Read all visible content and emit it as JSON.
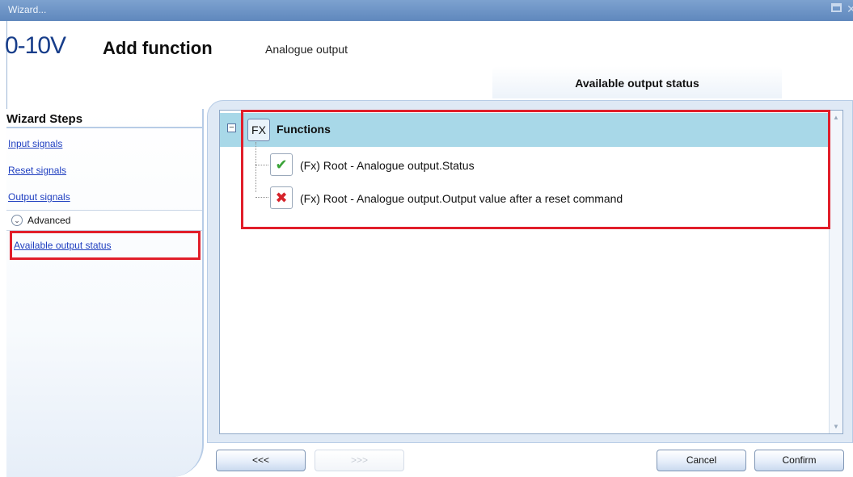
{
  "window": {
    "title": "Wizard..."
  },
  "header": {
    "logo_text": "0-10V",
    "title": "Add function",
    "subtitle": "Analogue output",
    "section_tab": "Available output status"
  },
  "wizard_steps": {
    "title": "Wizard Steps",
    "items": [
      {
        "label": "Input signals"
      },
      {
        "label": "Reset signals"
      },
      {
        "label": "Output signals"
      }
    ],
    "advanced_label": "Advanced",
    "active_item": "Available output status"
  },
  "tree": {
    "root_badge": "FX",
    "root_label": "Functions",
    "items": [
      {
        "label": "(Fx) Root - Analogue output.Status",
        "status_icon": "check-icon"
      },
      {
        "label": "(Fx) Root - Analogue output.Output value after a reset command",
        "status_icon": "cross-icon"
      }
    ]
  },
  "buttons": {
    "back": "<<<",
    "next": ">>>",
    "cancel": "Cancel",
    "confirm": "Confirm"
  },
  "colors": {
    "highlight": "#e11e2a",
    "title_bar": "#6f95c6",
    "link": "#1f3fc0",
    "tree_header": "#a8d8e8"
  }
}
